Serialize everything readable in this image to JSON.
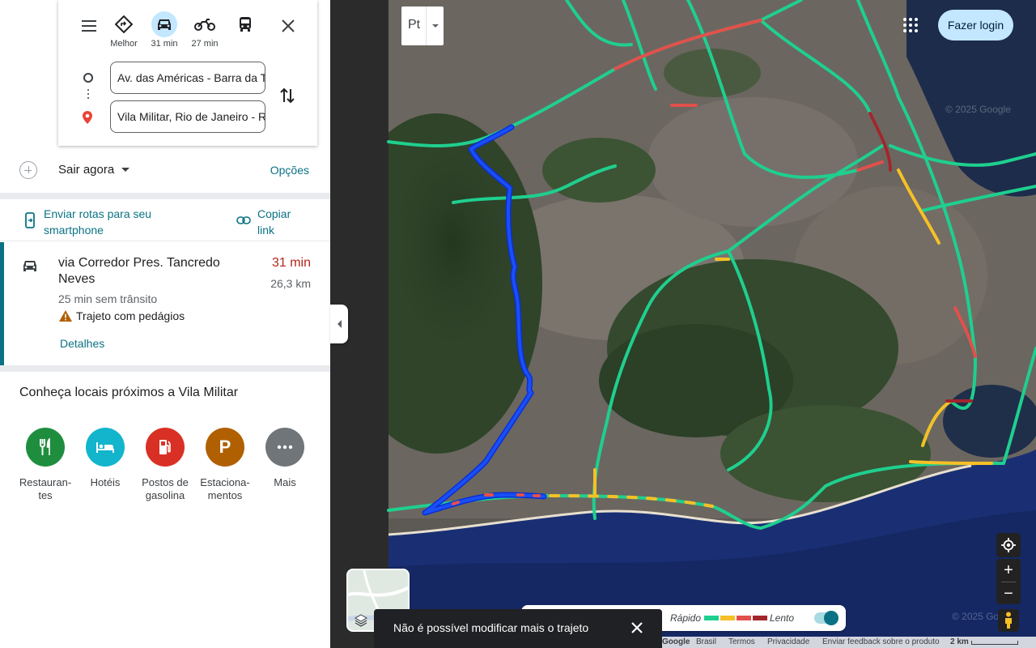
{
  "modes": [
    {
      "label": "Melhor",
      "icon": "directions-icon"
    },
    {
      "label": "31 min",
      "icon": "car-icon",
      "active": true
    },
    {
      "label": "27 min",
      "icon": "motorcycle-icon"
    },
    {
      "label": "",
      "icon": "transit-icon"
    }
  ],
  "origin": {
    "value": "Av. das Américas - Barra da Tijuca"
  },
  "destination": {
    "value": "Vila Militar, Rio de Janeiro - RJ"
  },
  "depart": {
    "label": "Sair agora",
    "options_label": "Opções"
  },
  "share": {
    "send_label": "Enviar rotas para seu smartphone",
    "copy_label": "Copiar link"
  },
  "route": {
    "title": "via Corredor Pres. Tancredo Neves",
    "time": "31 min",
    "distance": "26,3 km",
    "no_traffic": "25 min sem trânsito",
    "toll_warning": "Trajeto com pedágios",
    "details_label": "Detalhes"
  },
  "nearby": {
    "title": "Conheça locais próximos a Vila Militar",
    "categories": [
      {
        "label": "Restauran-\ntes",
        "color": "#1e8e3e",
        "icon": "restaurant-icon"
      },
      {
        "label": "Hotéis",
        "color": "#12b5cb",
        "icon": "hotel-icon"
      },
      {
        "label": "Postos de\ngasolina",
        "color": "#d93025",
        "icon": "gas-station-icon"
      },
      {
        "label": "Estaciona-\nmentos",
        "color": "#b06000",
        "icon": "parking-icon"
      },
      {
        "label": "Mais",
        "color": "#70757a",
        "icon": "more-icon"
      }
    ]
  },
  "map": {
    "pt_label": "Pt",
    "login_label": "Fazer login",
    "layers_label": "Camadas",
    "traffic_legend": {
      "fast": "Rápido",
      "slow": "Lento",
      "colors": [
        "#1fcf8f",
        "#f6c026",
        "#e2504b",
        "#a3252c"
      ]
    },
    "toast": "Não é possível modificar mais o trajeto",
    "footer": [
      "Google",
      "Brasil",
      "Termos",
      "Privacidade",
      "Enviar feedback sobre o produto"
    ],
    "scale_label": "2 km",
    "watermark": "© 2025 Google"
  },
  "colors": {
    "accent": "#0b7285",
    "route": "#1a4ff5",
    "traffic_fast": "#1fcf8f",
    "time_red": "#b3261e"
  }
}
